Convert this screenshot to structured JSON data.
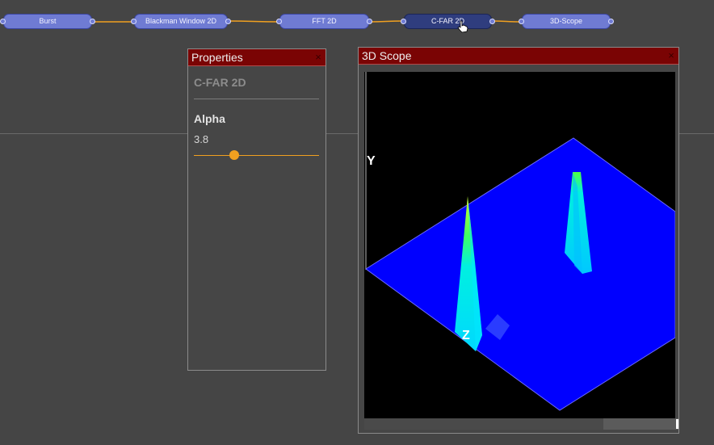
{
  "pipeline": {
    "nodes": [
      {
        "id": "burst",
        "label": "Burst",
        "selected": false
      },
      {
        "id": "blackman",
        "label": "Blackman Window 2D",
        "selected": false
      },
      {
        "id": "fft",
        "label": "FFT 2D",
        "selected": false
      },
      {
        "id": "cfar",
        "label": "C-FAR 2D",
        "selected": true
      },
      {
        "id": "scope",
        "label": "3D-Scope",
        "selected": false
      }
    ],
    "link_color": "#f0a020"
  },
  "properties": {
    "title": "Properties",
    "close_glyph": "×",
    "node_name": "C-FAR 2D",
    "params": [
      {
        "label": "Alpha",
        "value": "3.8",
        "fraction": 0.32
      }
    ]
  },
  "scope": {
    "title": "3D Scope",
    "close_glyph": "×",
    "axes": {
      "y": "Y",
      "z": "Z"
    },
    "colors": {
      "surface": "#0000ff",
      "peak_low": "#00d8ff",
      "peak_mid": "#40ff60",
      "peak_high": "#e0ff20"
    }
  }
}
